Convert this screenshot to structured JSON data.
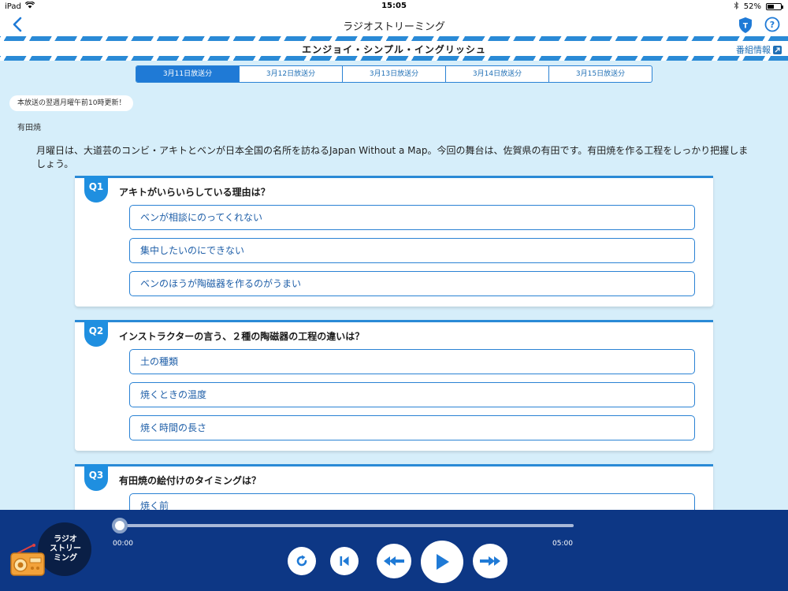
{
  "status_bar": {
    "device": "iPad",
    "time": "15:05",
    "battery_text": "52%",
    "battery_level": 0.52
  },
  "nav": {
    "title": "ラジオストリーミング"
  },
  "program": {
    "title": "エンジョイ・シンプル・イングリッシュ",
    "info_link": "番組情報"
  },
  "tabs": [
    {
      "label": "3月11日放送分",
      "active": true
    },
    {
      "label": "3月12日放送分",
      "active": false
    },
    {
      "label": "3月13日放送分",
      "active": false
    },
    {
      "label": "3月14日放送分",
      "active": false
    },
    {
      "label": "3月15日放送分",
      "active": false
    }
  ],
  "notice": "本放送の翌週月曜午前10時更新！",
  "episode": {
    "title": "有田焼",
    "description": "月曜日は、大道芸のコンビ・アキトとベンが日本全国の名所を訪ねるJapan Without a Map。今回の舞台は、佐賀県の有田です。有田焼を作る工程をしっかり把握しましょう。"
  },
  "questions": [
    {
      "label": "Q1",
      "text": "アキトがいらいらしている理由は？",
      "options": [
        "ベンが相談にのってくれない",
        "集中したいのにできない",
        "ベンのほうが陶磁器を作るのがうまい"
      ]
    },
    {
      "label": "Q2",
      "text": "インストラクターの言う、２種の陶磁器の工程の違いは？",
      "options": [
        "土の種類",
        "焼くときの温度",
        "焼く時間の長さ"
      ]
    },
    {
      "label": "Q3",
      "text": "有田焼の絵付けのタイミングは？",
      "options": [
        "焼く前"
      ]
    }
  ],
  "player": {
    "logo_line1": "ラジオ",
    "logo_line2": "ストリー",
    "logo_line3": "ミング",
    "current_time": "00:00",
    "duration": "05:00",
    "progress": 0.0
  },
  "colors": {
    "accent": "#1f7ad6",
    "player_bg": "#0d3785",
    "page_bg": "#d6eefa"
  }
}
